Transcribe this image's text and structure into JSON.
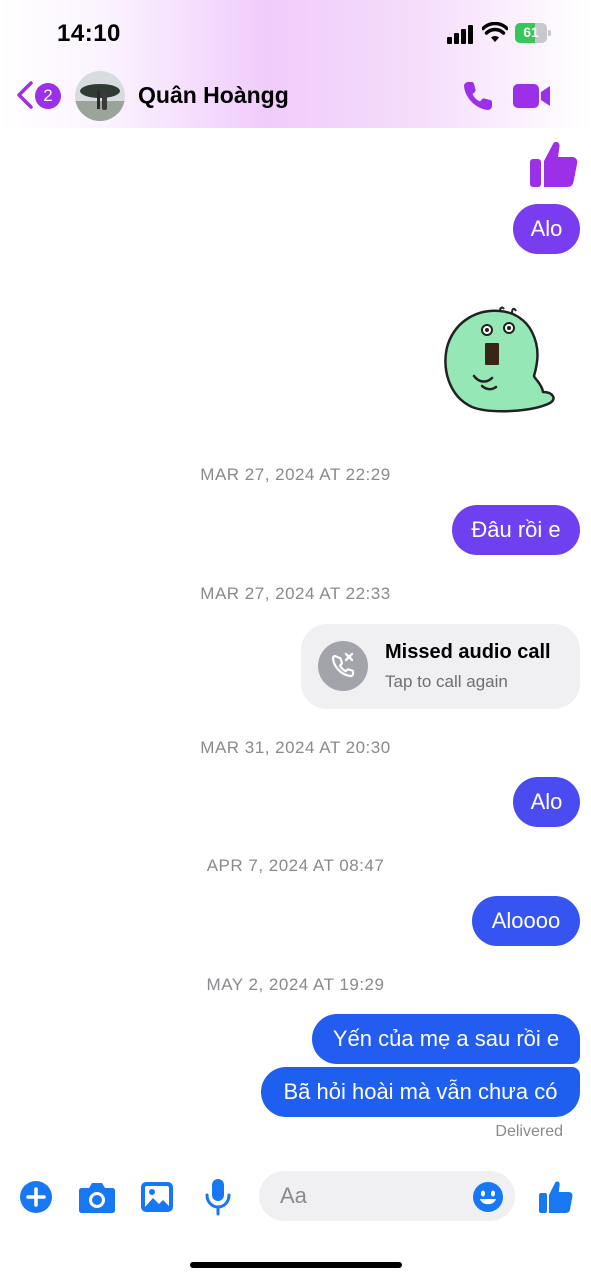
{
  "status_bar": {
    "time": "14:10",
    "battery": "61",
    "battery_level": 0.61
  },
  "header": {
    "back_badge": "2",
    "contact_name": "Quân Hoàngg"
  },
  "colors": {
    "accent": "#9b30e8",
    "bubble_purple": "#7a3cf0",
    "bubble_indigo": "#4a4bf0",
    "bubble_blue": "#1f5ff0",
    "composer_blue": "#1877f2"
  },
  "messages": {
    "m1": "Alo",
    "ts1": "MAR 27, 2024 AT 22:29",
    "m2": "Đâu rồi e",
    "ts2": "MAR 27, 2024 AT 22:33",
    "missed_title": "Missed audio call",
    "missed_sub": "Tap to call again",
    "ts3": "MAR 31, 2024 AT 20:30",
    "m3": "Alo",
    "ts4": "APR 7, 2024 AT 08:47",
    "m4": "Aloooo",
    "ts5": "MAY 2, 2024 AT 19:29",
    "m5": "Yến của mẹ a sau rồi e",
    "m6": "Bã hỏi hoài mà vẫn chưa có",
    "delivered": "Delivered"
  },
  "composer": {
    "placeholder": "Aa"
  },
  "icons": [
    "thumbs-up-icon",
    "sticker-icon",
    "phone-icon",
    "video-icon",
    "plus-icon",
    "camera-icon",
    "gallery-icon",
    "microphone-icon",
    "emoji-icon"
  ]
}
